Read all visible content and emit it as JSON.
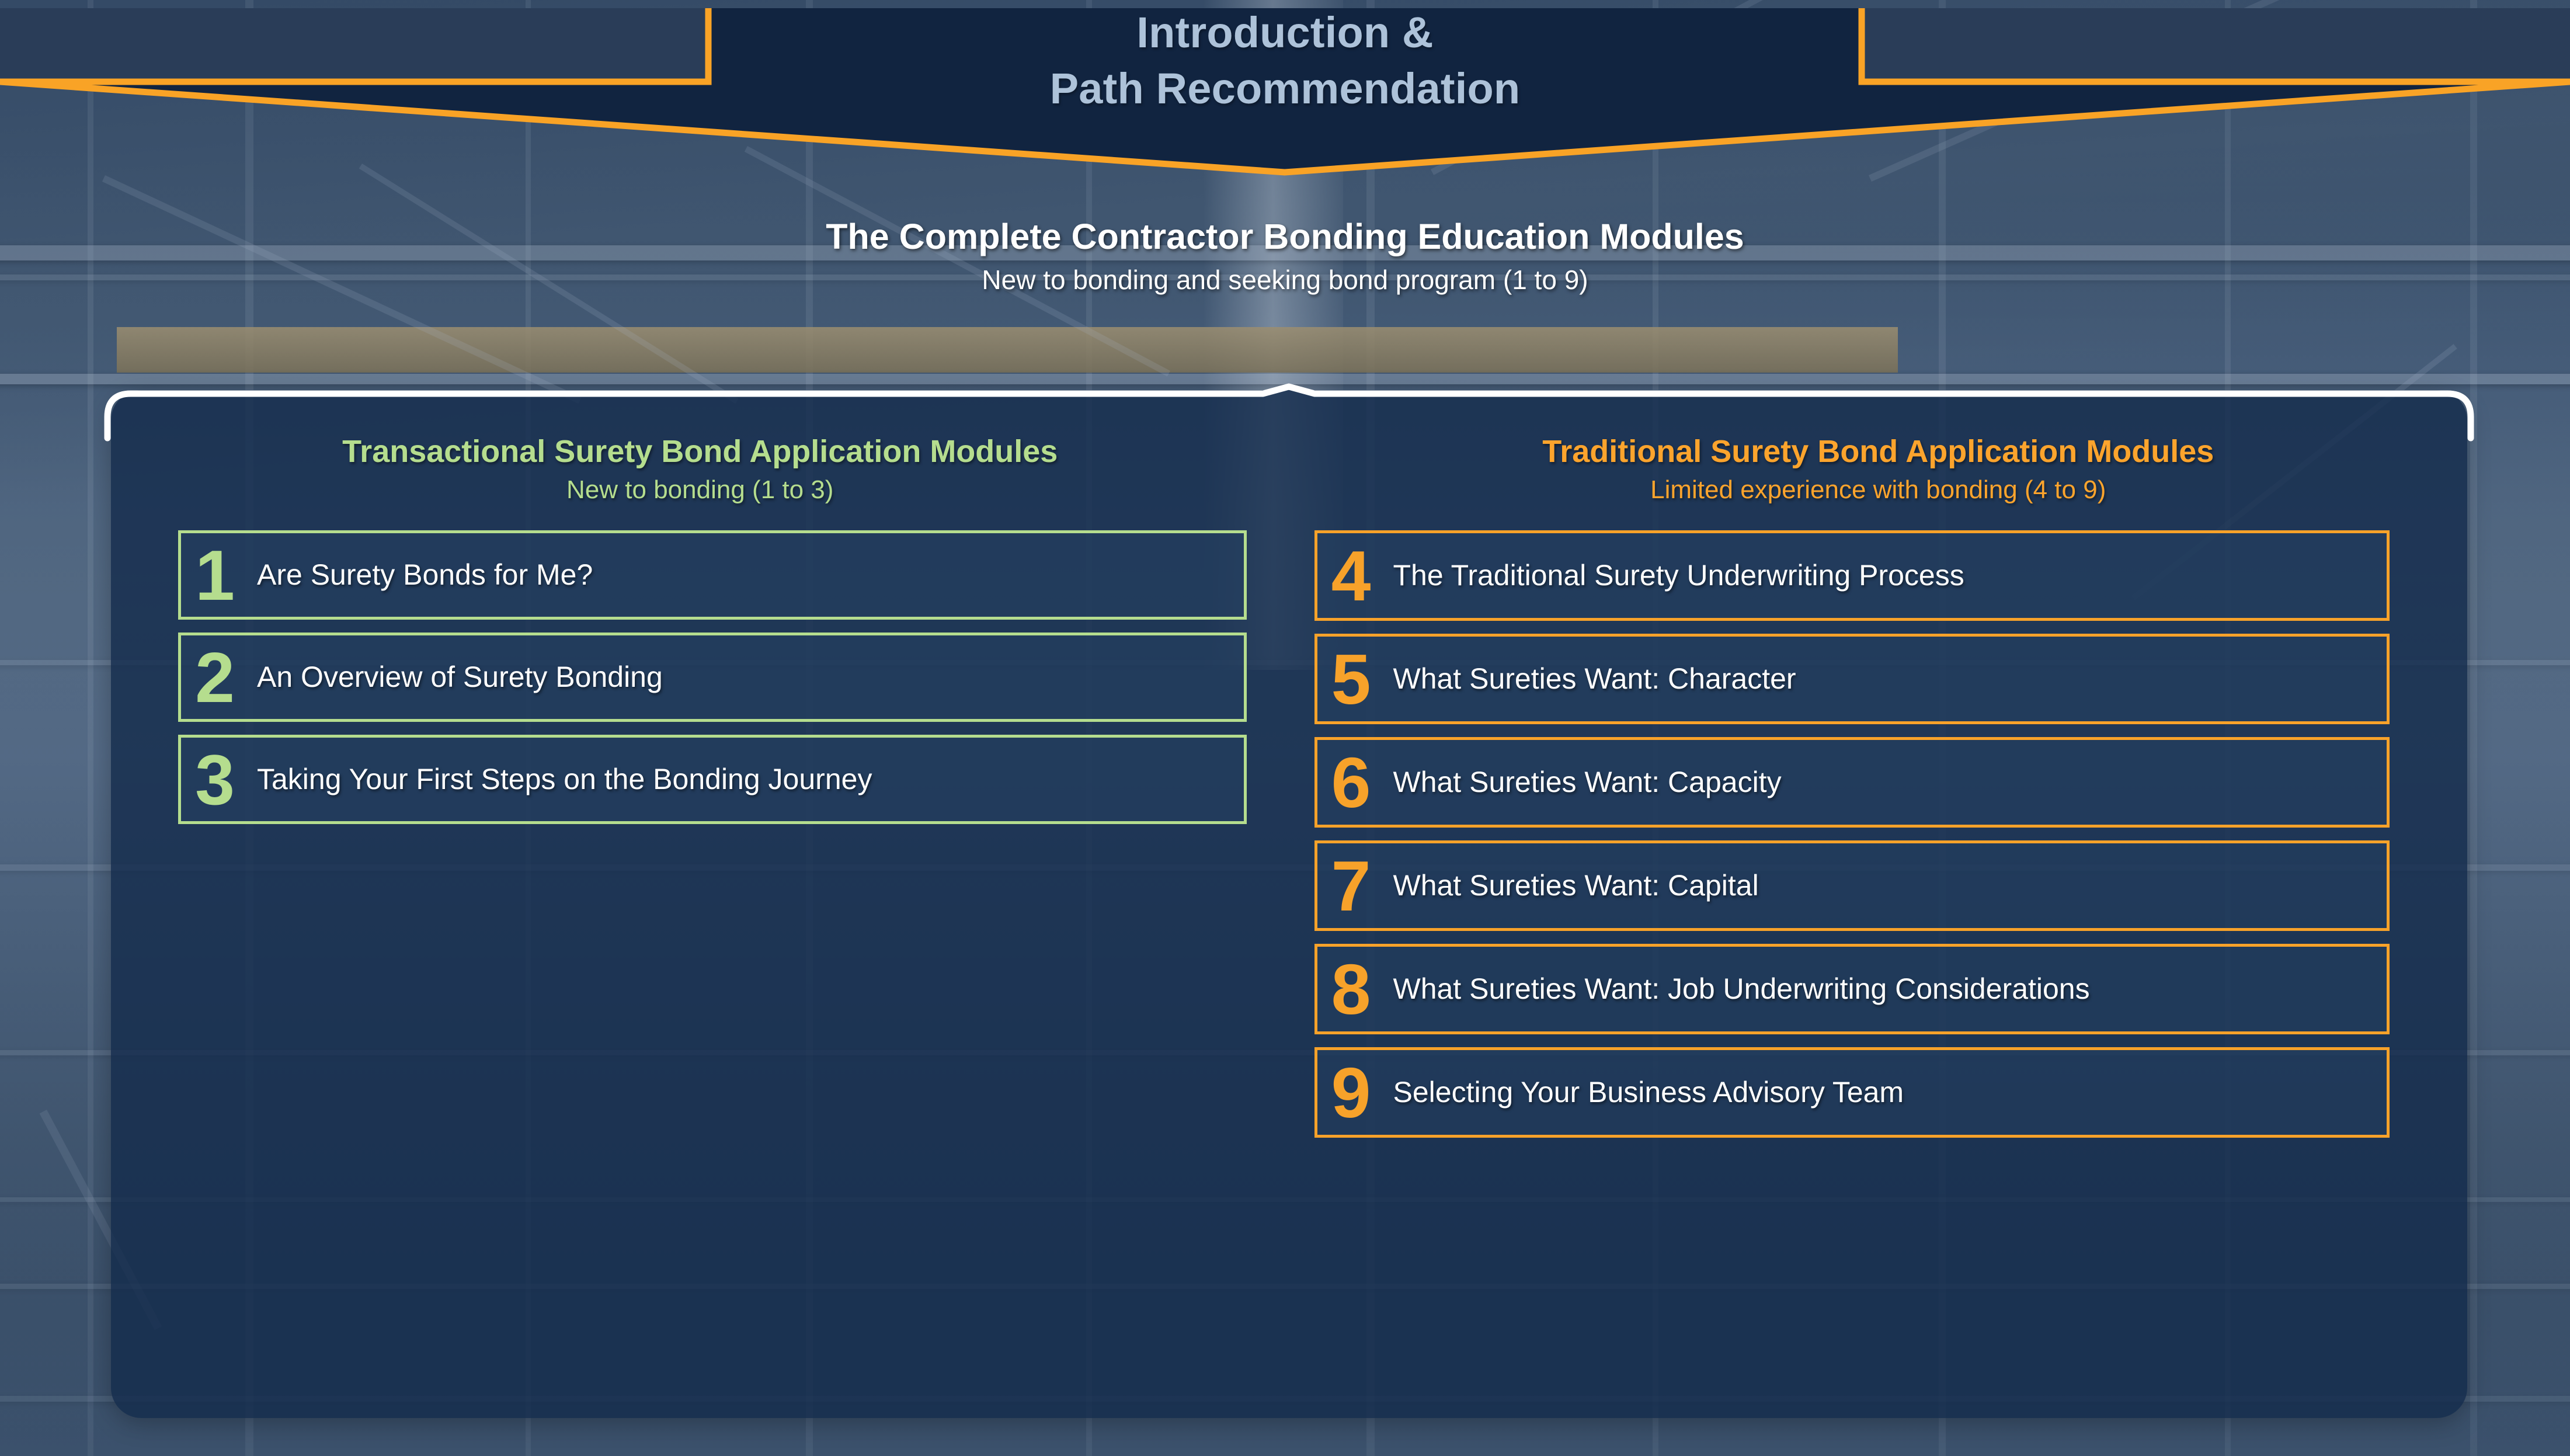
{
  "header": {
    "title_line1": "Introduction &",
    "title_line2": "Path Recommendation",
    "title": "Introduction &\nPath Recommendation",
    "accent_color": "#F9A326",
    "banner_fill": "#112440",
    "wing_fill": "#2a3d58",
    "title_color": "#adc2d9"
  },
  "subhead": {
    "headline": "The Complete Contractor Bonding Education Modules",
    "subtitle": "New to bonding and seeking bond program (1 to 9)"
  },
  "columns": [
    {
      "id": "transactional",
      "title": "Transactional Surety Bond Application Modules",
      "subtitle": "New to bonding (1 to 3)",
      "accent_color": "#B5DD8E",
      "modules": [
        {
          "number": "1",
          "label": "Are Surety Bonds for Me?"
        },
        {
          "number": "2",
          "label": "An Overview of Surety Bonding"
        },
        {
          "number": "3",
          "label": "Taking Your First Steps on the Bonding Journey"
        }
      ]
    },
    {
      "id": "traditional",
      "title": "Traditional Surety Bond Application Modules",
      "subtitle": "Limited experience with bonding (4 to 9)",
      "accent_color": "#F7A22A",
      "modules": [
        {
          "number": "4",
          "label": "The Traditional Surety Underwriting Process"
        },
        {
          "number": "5",
          "label": "What Sureties Want: Character"
        },
        {
          "number": "6",
          "label": "What Sureties Want: Capacity"
        },
        {
          "number": "7",
          "label": "What Sureties Want: Capital"
        },
        {
          "number": "8",
          "label": "What Sureties Want: Job Underwriting Considerations"
        },
        {
          "number": "9",
          "label": "Selecting Your Business Advisory Team"
        }
      ]
    }
  ],
  "panel": {
    "border_color": "#FFFFFF",
    "fill_color": "#132A4B"
  }
}
